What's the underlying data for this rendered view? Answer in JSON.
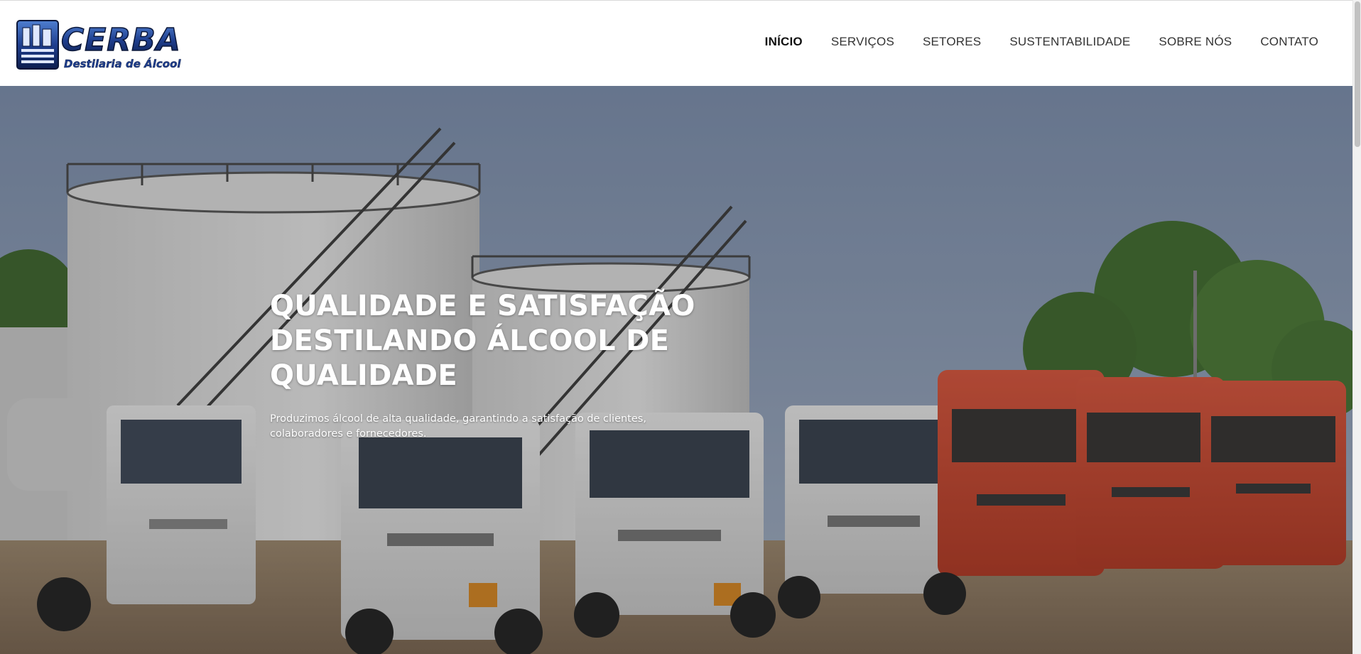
{
  "brand": {
    "name": "CERBA",
    "tagline": "Destilaria de Álcool",
    "colors": {
      "primary": "#1f3f8f",
      "dark": "#0e1f4d"
    }
  },
  "nav": {
    "items": [
      {
        "label": "INÍCIO",
        "active": true
      },
      {
        "label": "SERVIÇOS",
        "active": false
      },
      {
        "label": "SETORES",
        "active": false
      },
      {
        "label": "SUSTENTABILIDADE",
        "active": false
      },
      {
        "label": "SOBRE NÓS",
        "active": false
      },
      {
        "label": "CONTATO",
        "active": false
      }
    ]
  },
  "hero": {
    "title_lines": [
      "QUALIDADE E SATISFAÇÃO",
      "DESTILANDO ÁLCOOL DE",
      "QUALIDADE"
    ],
    "subtitle": "Produzimos álcool de alta qualidade, garantindo a satisfação de clientes, colaboradores e fornecedores.",
    "image": "photo of white storage tanks and a line of white and red tanker trucks"
  }
}
